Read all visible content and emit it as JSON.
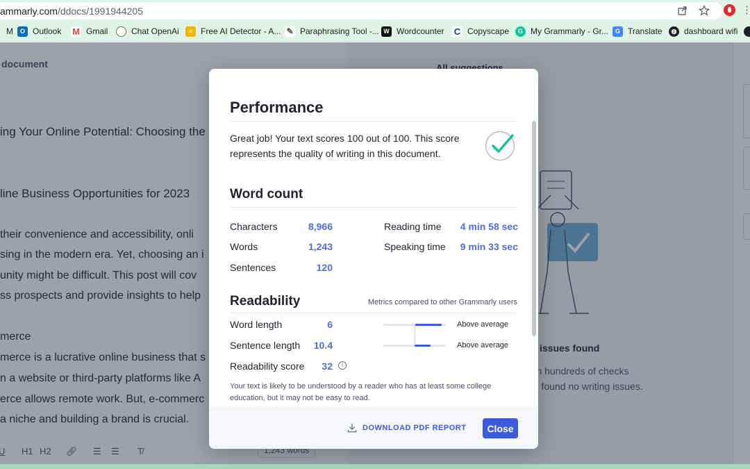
{
  "browser": {
    "url_host": "ammarly.com",
    "url_path": "/ddocs/1991944205",
    "icons": [
      "share-icon",
      "star-icon",
      "extension-icon",
      "menu-icon"
    ],
    "bookmarks": [
      {
        "label": "M",
        "icon": "gmail-partial-icon",
        "color": "#c5221f"
      },
      {
        "label": "Outlook",
        "icon": "outlook-icon",
        "color": "#0f6cbd"
      },
      {
        "label": "Gmail",
        "icon": "gmail-icon",
        "color": "#ea4335"
      },
      {
        "label": "Chat OpenAi",
        "icon": "openai-icon",
        "color": "#6b6b6b"
      },
      {
        "label": "Free AI Detector - A...",
        "icon": "ai-detector-icon",
        "color": "#f2b600"
      },
      {
        "label": "Paraphrasing Tool -...",
        "icon": "quill-icon",
        "color": "#555555"
      },
      {
        "label": "Wordcounter",
        "icon": "wordcounter-icon",
        "color": "#111111"
      },
      {
        "label": "Copyscape",
        "icon": "copyscape-icon",
        "color": "#1a3f8f"
      },
      {
        "label": "My Grammarly - Gr...",
        "icon": "grammarly-icon",
        "color": "#15c39a"
      },
      {
        "label": "Translate",
        "icon": "translate-icon",
        "color": "#4285f4"
      },
      {
        "label": "dashboard wifi",
        "icon": "globe-icon",
        "color": "#202124"
      }
    ]
  },
  "editor": {
    "doc_label": "document",
    "lines": [
      "ing Your Online Potential: Choosing the R",
      "line Business Opportunities for 2023",
      " their convenience and accessibility, onli",
      "sing in the modern era. Yet, choosing an i",
      "unity might be difficult. This post will cov",
      "ss prospects and provide insights to help",
      "merce",
      "merce is a lucrative online business that s",
      "n a website or third-party platforms like A",
      "erce allows remote work. But, e-commerc",
      " a niche and building a brand is crucial."
    ],
    "toolbar": {
      "underline": "U",
      "h1": "H1",
      "h2": "H2",
      "word_count": "1,243 words"
    }
  },
  "sidebar": {
    "all_suggestions": "All suggestions",
    "no_issues_title": "issues found",
    "no_issues_sub": [
      "ran hundreds of checks",
      "nd found no writing issues."
    ]
  },
  "modal": {
    "title": "Performance",
    "performance_text": "Great job! Your text scores 100 out of 100. This score represents the quality of writing in this document.",
    "word_count": {
      "title": "Word count",
      "stats": [
        {
          "label": "Characters",
          "value": "8,966"
        },
        {
          "label": "Words",
          "value": "1,243"
        },
        {
          "label": "Sentences",
          "value": "120"
        }
      ],
      "times": [
        {
          "label": "Reading time",
          "value": "4 min 58 sec"
        },
        {
          "label": "Speaking time",
          "value": "9 min 33 sec"
        }
      ]
    },
    "readability": {
      "title": "Readability",
      "note": "Metrics compared to other Grammarly users",
      "metrics": [
        {
          "label": "Word length",
          "value": "6",
          "level": 0.93,
          "rating": "Above average"
        },
        {
          "label": "Sentence length",
          "value": "10.4",
          "level": 0.75,
          "rating": "Above average"
        },
        {
          "label": "Readability score",
          "value": "32"
        }
      ],
      "description": "Your text is likely to be understood by a reader who has at least some college education, but it may not be easy to read."
    },
    "footer": {
      "download_label": "DOWNLOAD PDF REPORT",
      "close_label": "Close"
    },
    "accent_color": "#3b5bdb",
    "success_color": "#15c39a"
  }
}
